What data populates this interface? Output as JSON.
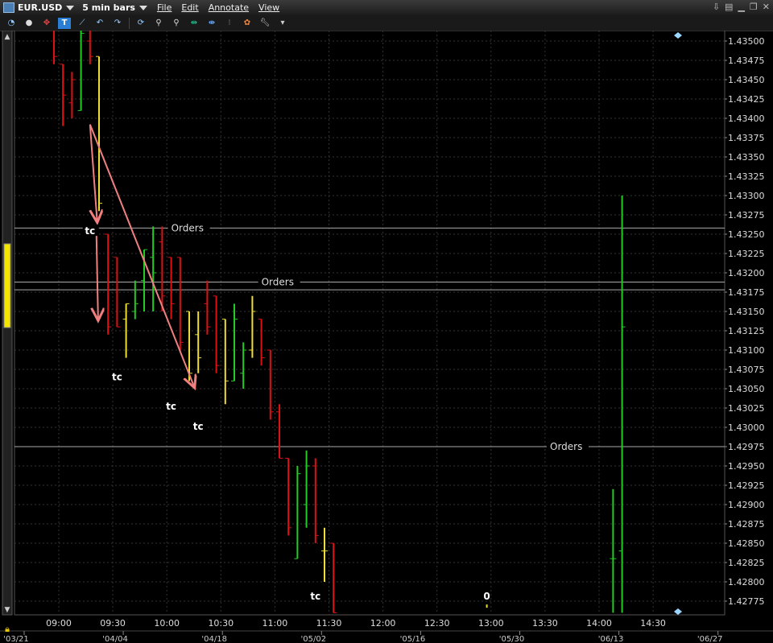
{
  "window": {
    "symbol": "EUR.USD",
    "bar_size": "5 min bars",
    "menu": [
      "File",
      "Edit",
      "Annotate",
      "View"
    ]
  },
  "toolbar": {
    "icons": [
      "clock-icon",
      "record-icon",
      "crosshair-icon",
      "text-tool-icon",
      "line-tool-icon",
      "undo-icon",
      "redo-icon",
      "refresh-icon",
      "zoom-in-icon",
      "zoom-out-icon",
      "fit-icon",
      "expand-icon",
      "layout-icon",
      "color-picker-icon",
      "wrench-icon",
      "dropdown-icon"
    ]
  },
  "colors": {
    "up": "#22cc22",
    "down": "#dd1111",
    "neutral": "#eedd33",
    "annotation": "#f08080",
    "grid": "#333333",
    "orders": "#aaaaaa"
  },
  "chart_data": {
    "type": "bar",
    "ylim": [
      1.4276,
      1.4351
    ],
    "y_ticks": [
      "1.43500",
      "1.43475",
      "1.43450",
      "1.43425",
      "1.43400",
      "1.43375",
      "1.43350",
      "1.43325",
      "1.43300",
      "1.43275",
      "1.43250",
      "1.43225",
      "1.43200",
      "1.43175",
      "1.43150",
      "1.43125",
      "1.43100",
      "1.43075",
      "1.43050",
      "1.43025",
      "1.43000",
      "1.42975",
      "1.42950",
      "1.42925",
      "1.42900",
      "1.42875",
      "1.42850",
      "1.42825",
      "1.42800",
      "1.42775"
    ],
    "x_ticks": [
      "09:00",
      "09:30",
      "10:00",
      "10:30",
      "11:00",
      "11:30",
      "12:00",
      "12:30",
      "13:00",
      "13:30",
      "14:00",
      "14:30"
    ],
    "date_ticks": [
      "'03/21",
      "'04/04",
      "'04/18",
      "'05/02",
      "'05/16",
      "'05/30",
      "'06/13",
      "'06/27"
    ],
    "bars": [
      {
        "i": 0,
        "o": 1.4352,
        "h": 1.4352,
        "l": 1.4347,
        "c": 1.4348,
        "d": "down"
      },
      {
        "i": 1,
        "o": 1.4347,
        "h": 1.4347,
        "l": 1.4339,
        "c": 1.4343,
        "d": "down"
      },
      {
        "i": 2,
        "o": 1.4342,
        "h": 1.4346,
        "l": 1.434,
        "c": 1.4345,
        "d": "down"
      },
      {
        "i": 3,
        "o": 1.4341,
        "h": 1.4352,
        "l": 1.4341,
        "c": 1.4351,
        "d": "up"
      },
      {
        "i": 4,
        "o": 1.435,
        "h": 1.4352,
        "l": 1.4347,
        "c": 1.4348,
        "d": "down"
      },
      {
        "i": 5,
        "o": 1.4348,
        "h": 1.4348,
        "l": 1.4328,
        "c": 1.4329,
        "d": "neutral"
      },
      {
        "i": 6,
        "o": 1.4325,
        "h": 1.4325,
        "l": 1.4312,
        "c": 1.4313,
        "d": "down"
      },
      {
        "i": 7,
        "o": 1.4322,
        "h": 1.4322,
        "l": 1.4313,
        "c": 1.4313,
        "d": "down"
      },
      {
        "i": 8,
        "o": 1.4314,
        "h": 1.4316,
        "l": 1.4309,
        "c": 1.4316,
        "d": "neutral"
      },
      {
        "i": 9,
        "o": 1.4315,
        "h": 1.4319,
        "l": 1.4314,
        "c": 1.4316,
        "d": "up"
      },
      {
        "i": 10,
        "o": 1.4319,
        "h": 1.4323,
        "l": 1.4315,
        "c": 1.4323,
        "d": "up"
      },
      {
        "i": 11,
        "o": 1.4322,
        "h": 1.4326,
        "l": 1.4315,
        "c": 1.432,
        "d": "up"
      },
      {
        "i": 12,
        "o": 1.4324,
        "h": 1.4326,
        "l": 1.4315,
        "c": 1.4317,
        "d": "down"
      },
      {
        "i": 13,
        "o": 1.4322,
        "h": 1.4322,
        "l": 1.4314,
        "c": 1.4316,
        "d": "down"
      },
      {
        "i": 14,
        "o": 1.4322,
        "h": 1.4322,
        "l": 1.431,
        "c": 1.4311,
        "d": "down"
      },
      {
        "i": 15,
        "o": 1.4315,
        "h": 1.4315,
        "l": 1.4306,
        "c": 1.4307,
        "d": "neutral"
      },
      {
        "i": 16,
        "o": 1.4312,
        "h": 1.4315,
        "l": 1.4307,
        "c": 1.4309,
        "d": "neutral"
      },
      {
        "i": 17,
        "o": 1.4316,
        "h": 1.4319,
        "l": 1.4312,
        "c": 1.4313,
        "d": "down"
      },
      {
        "i": 18,
        "o": 1.4317,
        "h": 1.4317,
        "l": 1.4307,
        "c": 1.4308,
        "d": "down"
      },
      {
        "i": 19,
        "o": 1.4314,
        "h": 1.4314,
        "l": 1.4303,
        "c": 1.4306,
        "d": "neutral"
      },
      {
        "i": 20,
        "o": 1.4306,
        "h": 1.4316,
        "l": 1.4306,
        "c": 1.4314,
        "d": "up"
      },
      {
        "i": 21,
        "o": 1.4307,
        "h": 1.4311,
        "l": 1.4305,
        "c": 1.431,
        "d": "up"
      },
      {
        "i": 22,
        "o": 1.431,
        "h": 1.4317,
        "l": 1.4309,
        "c": 1.4315,
        "d": "neutral"
      },
      {
        "i": 23,
        "o": 1.4314,
        "h": 1.4314,
        "l": 1.4308,
        "c": 1.4309,
        "d": "down"
      },
      {
        "i": 24,
        "o": 1.431,
        "h": 1.431,
        "l": 1.4301,
        "c": 1.4302,
        "d": "down"
      },
      {
        "i": 25,
        "o": 1.4302,
        "h": 1.4303,
        "l": 1.4296,
        "c": 1.4296,
        "d": "down"
      },
      {
        "i": 26,
        "o": 1.4296,
        "h": 1.4296,
        "l": 1.4286,
        "c": 1.4287,
        "d": "down"
      },
      {
        "i": 27,
        "o": 1.4283,
        "h": 1.4295,
        "l": 1.4283,
        "c": 1.4294,
        "d": "up"
      },
      {
        "i": 28,
        "o": 1.429,
        "h": 1.4297,
        "l": 1.4287,
        "c": 1.4295,
        "d": "up"
      },
      {
        "i": 29,
        "o": 1.4295,
        "h": 1.4296,
        "l": 1.4285,
        "c": 1.4286,
        "d": "down"
      },
      {
        "i": 30,
        "o": 1.4284,
        "h": 1.4287,
        "l": 1.428,
        "c": 1.4284,
        "d": "neutral"
      },
      {
        "i": 31,
        "o": 1.4285,
        "h": 1.4285,
        "l": 1.4276,
        "c": 1.4276,
        "d": "down"
      },
      {
        "i": 62,
        "o": 1.4283,
        "h": 1.4292,
        "l": 1.4276,
        "c": 1.4283,
        "d": "up"
      },
      {
        "i": 63,
        "o": 1.4284,
        "h": 1.433,
        "l": 1.4276,
        "c": 1.4313,
        "d": "up"
      }
    ],
    "tc_labels": [
      {
        "text": "tc",
        "bar": 4,
        "price": 1.43252
      },
      {
        "text": "tc",
        "bar": 7,
        "price": 1.43063
      },
      {
        "text": "tc",
        "bar": 13,
        "price": 1.43025
      },
      {
        "text": "tc",
        "bar": 16,
        "price": 1.42999
      },
      {
        "text": "tc",
        "bar": 29,
        "price": 1.42779
      }
    ],
    "zero_label": {
      "text": "0",
      "bar": 48,
      "price": 1.42779
    },
    "order_lines": [
      {
        "price": 1.43258,
        "label": "Orders",
        "label_bar": 13
      },
      {
        "price": 1.43188,
        "label": "Orders",
        "label_bar": 23
      },
      {
        "price": 1.43178,
        "label": null
      },
      {
        "price": 1.42975,
        "label": "Orders",
        "label_bar": 55
      }
    ],
    "arrows": [
      {
        "from": [
          4,
          1.43392
        ],
        "to": [
          4.8,
          1.43265
        ]
      },
      {
        "from": [
          4,
          1.43392
        ],
        "to": [
          15.6,
          1.43051
        ]
      },
      {
        "from": [
          4.7,
          1.43255
        ],
        "to": [
          4.9,
          1.43138
        ]
      }
    ]
  }
}
